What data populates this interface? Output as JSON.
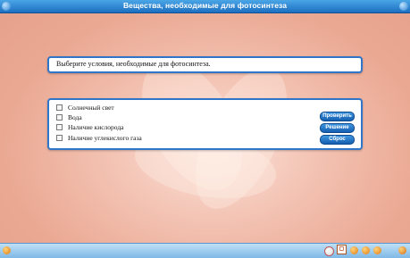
{
  "window": {
    "title": "Вещества, необходимые для фотосинтеза"
  },
  "question": {
    "text": "Выберите условия, необходимые для фотосинтеза."
  },
  "options": [
    {
      "label": "Солнечный свет",
      "checked": false
    },
    {
      "label": "Вода",
      "checked": false
    },
    {
      "label": "Наличие кислорода",
      "checked": false
    },
    {
      "label": "Наличие углекислого газа",
      "checked": false
    }
  ],
  "buttons": {
    "check": "Проверить",
    "solution": "Решение",
    "reset": "Сброс"
  },
  "colors": {
    "accent": "#2f76c8",
    "title_bar": "#1d6fc0",
    "background": "#f3c2b2"
  },
  "icons": {
    "left_tool": "wrench-icon",
    "home": "home-icon",
    "back": "back-arrow-icon",
    "forward": "forward-arrow-icon",
    "sound": "speaker-icon",
    "edit": "pencil-icon"
  }
}
